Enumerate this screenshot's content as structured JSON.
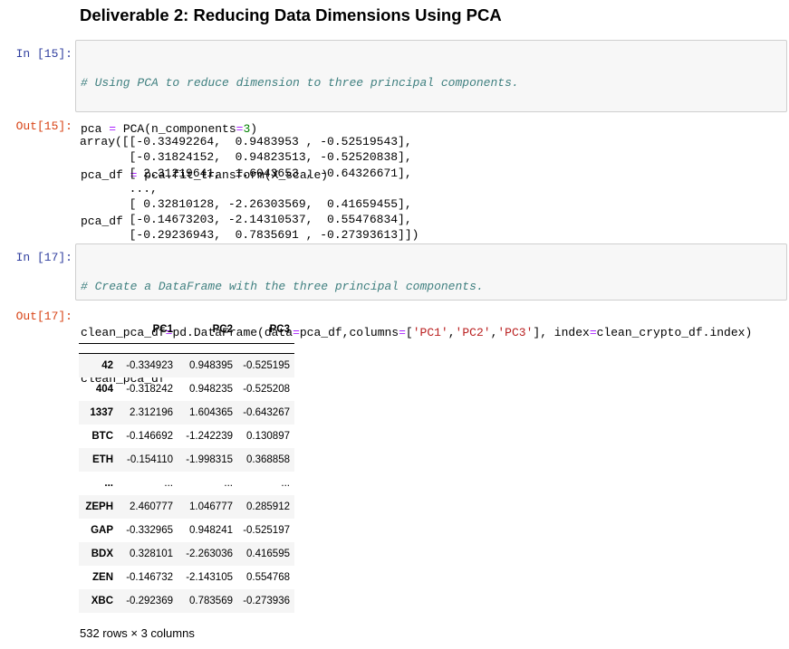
{
  "heading": "Deliverable 2: Reducing Data Dimensions Using PCA",
  "cells": [
    {
      "prompt": "In [15]:",
      "code_lines": [
        "# Using PCA to reduce dimension to three principal components.",
        "pca = PCA(n_components=3)",
        "pca_df = pca.fit_transform(X_scale)",
        "pca_df"
      ],
      "out_prompt": "Out[15]:",
      "output_lines": [
        "array([[-0.33492264,  0.9483953 , -0.52519543],",
        "       [-0.31824152,  0.94823513, -0.52520838],",
        "       [ 2.31219641,  1.6043653 , -0.64326671],",
        "       ...,",
        "       [ 0.32810128, -2.26303569,  0.41659455],",
        "       [-0.14673203, -2.14310537,  0.55476834],",
        "       [-0.29236943,  0.7835691 , -0.27393613]])"
      ]
    },
    {
      "prompt": "In [17]:",
      "code_lines": [
        "# Create a DataFrame with the three principal components.",
        "clean_pca_df=pd.DataFrame(data=pca_df,columns=['PC1','PC2','PC3'], index=clean_crypto_df.index)",
        "clean_pca_df"
      ],
      "out_prompt": "Out[17]:"
    }
  ],
  "dataframe": {
    "columns": [
      "PC1",
      "PC2",
      "PC3"
    ],
    "rows": [
      {
        "index": "42",
        "values": [
          "-0.334923",
          "0.948395",
          "-0.525195"
        ]
      },
      {
        "index": "404",
        "values": [
          "-0.318242",
          "0.948235",
          "-0.525208"
        ]
      },
      {
        "index": "1337",
        "values": [
          "2.312196",
          "1.604365",
          "-0.643267"
        ]
      },
      {
        "index": "BTC",
        "values": [
          "-0.146692",
          "-1.242239",
          "0.130897"
        ]
      },
      {
        "index": "ETH",
        "values": [
          "-0.154110",
          "-1.998315",
          "0.368858"
        ]
      },
      {
        "index": "...",
        "values": [
          "...",
          "...",
          "..."
        ]
      },
      {
        "index": "ZEPH",
        "values": [
          "2.460777",
          "1.046777",
          "0.285912"
        ]
      },
      {
        "index": "GAP",
        "values": [
          "-0.332965",
          "0.948241",
          "-0.525197"
        ]
      },
      {
        "index": "BDX",
        "values": [
          "0.328101",
          "-2.263036",
          "0.416595"
        ]
      },
      {
        "index": "ZEN",
        "values": [
          "-0.146732",
          "-2.143105",
          "0.554768"
        ]
      },
      {
        "index": "XBC",
        "values": [
          "-0.292369",
          "0.783569",
          "-0.273936"
        ]
      }
    ],
    "shape_text": "532 rows × 3 columns"
  }
}
